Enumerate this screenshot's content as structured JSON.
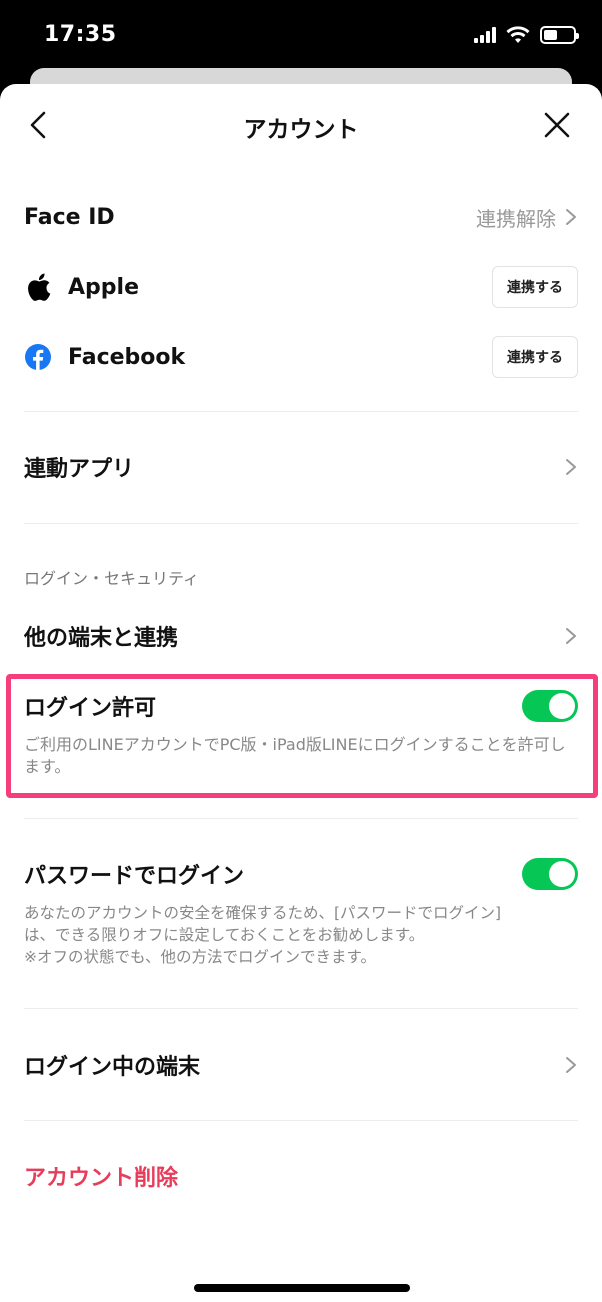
{
  "status_bar": {
    "time": "17:35"
  },
  "nav": {
    "title": "アカウント"
  },
  "face_id": {
    "label": "Face ID",
    "status": "連携解除"
  },
  "providers": [
    {
      "label": "Apple",
      "button": "連携する"
    },
    {
      "label": "Facebook",
      "button": "連携する"
    }
  ],
  "linked_apps": {
    "label": "連動アプリ"
  },
  "security_section": {
    "header": "ログイン・セキュリティ"
  },
  "other_devices": {
    "label": "他の端末と連携"
  },
  "allow_login": {
    "label": "ログイン許可",
    "enabled": true,
    "description": "ご利用のLINEアカウントでPC版・iPad版LINEにログインすることを許可します。"
  },
  "password_login": {
    "label": "パスワードでログイン",
    "enabled": true,
    "description_lines": [
      "あなたのアカウントの安全を確保するため、[パスワードでログイン]",
      "は、できる限りオフに設定しておくことをお勧めします。",
      "※オフの状態でも、他の方法でログインできます。"
    ]
  },
  "logged_in_devices": {
    "label": "ログイン中の端末"
  },
  "delete_account": {
    "label": "アカウント削除"
  },
  "colors": {
    "accent_green": "#06c755",
    "highlight": "#f53e7c",
    "danger": "#e83c5b",
    "facebook": "#1877f2"
  }
}
